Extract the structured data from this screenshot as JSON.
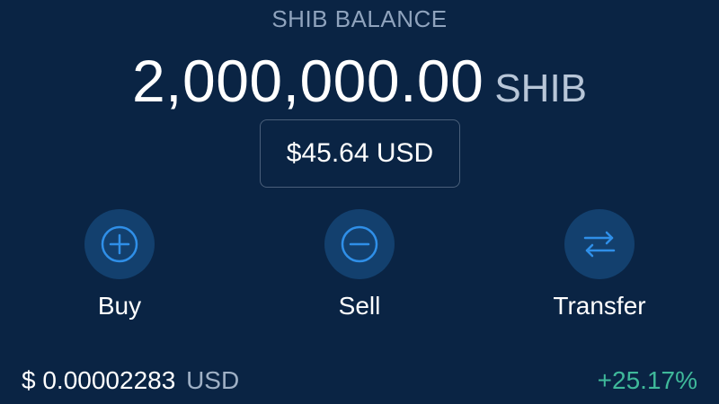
{
  "balance": {
    "label": "SHIB BALANCE",
    "amount": "2,000,000.00",
    "unit": "SHIB",
    "usd_value": "$45.64 USD"
  },
  "actions": [
    {
      "label": "Buy",
      "icon": "plus-circle-icon"
    },
    {
      "label": "Sell",
      "icon": "minus-circle-icon"
    },
    {
      "label": "Transfer",
      "icon": "transfer-arrows-icon"
    }
  ],
  "price": {
    "currency_symbol": "$",
    "value": "0.00002283",
    "unit": "USD",
    "change": "+25.17%"
  },
  "colors": {
    "background": "#0a2444",
    "accent": "#2f8fe8",
    "positive": "#3fb99a"
  }
}
